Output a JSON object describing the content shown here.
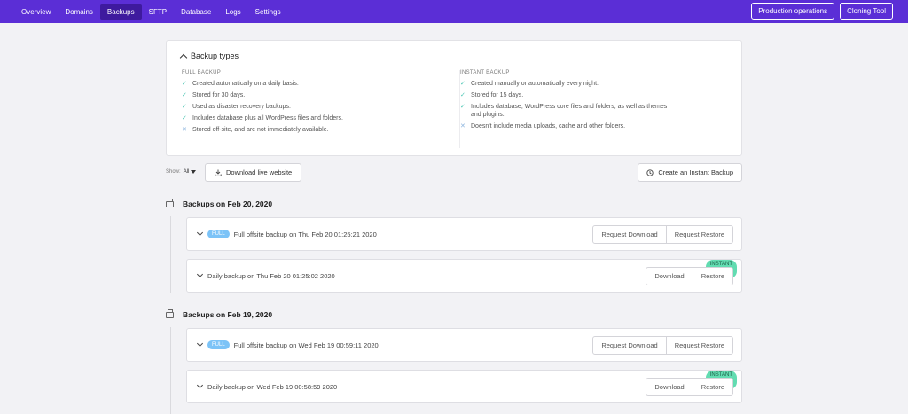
{
  "nav": {
    "items": [
      "Overview",
      "Domains",
      "Backups",
      "SFTP",
      "Database",
      "Logs",
      "Settings"
    ],
    "active": "Backups",
    "actions": [
      "Production operations",
      "Cloning Tool"
    ]
  },
  "types": {
    "title": "Backup types",
    "full": {
      "heading": "FULL BACKUP",
      "items": [
        {
          "text": "Created automatically on a daily basis.",
          "mark": "check"
        },
        {
          "text": "Stored for 30 days.",
          "mark": "check"
        },
        {
          "text": "Used as disaster recovery backups.",
          "mark": "check"
        },
        {
          "text": "Includes database plus all WordPress files and folders.",
          "mark": "check"
        },
        {
          "text": "Stored off-site, and are not immediately available.",
          "mark": "cross"
        }
      ]
    },
    "instant": {
      "heading": "INSTANT BACKUP",
      "items": [
        {
          "text": "Created manually or automatically every night.",
          "mark": "check"
        },
        {
          "text": "Stored for 15 days.",
          "mark": "check"
        },
        {
          "text": "Includes database, WordPress core files and folders, as well as themes and plugins.",
          "mark": "check"
        },
        {
          "text": "Doesn't include media uploads, cache and other folders.",
          "mark": "cross"
        }
      ]
    }
  },
  "controls": {
    "show_label": "Show:",
    "show_value": "All",
    "download_live": "Download live website",
    "create_instant": "Create an Instant Backup"
  },
  "groups": [
    {
      "title": "Backups on Feb 20, 2020",
      "rows": [
        {
          "badge": "FULL",
          "text": "Full offsite backup on Thu Feb 20 01:25:21 2020",
          "btn1": "Request Download",
          "btn2": "Request Restore"
        },
        {
          "badge": "INSTANT",
          "text": "Daily backup on Thu Feb 20 01:25:02 2020",
          "btn1": "Download",
          "btn2": "Restore"
        }
      ]
    },
    {
      "title": "Backups on Feb 19, 2020",
      "rows": [
        {
          "badge": "FULL",
          "text": "Full offsite backup on Wed Feb 19 00:59:11 2020",
          "btn1": "Request Download",
          "btn2": "Request Restore"
        },
        {
          "badge": "INSTANT",
          "text": "Daily backup on Wed Feb 19 00:58:59 2020",
          "btn1": "Download",
          "btn2": "Restore"
        }
      ]
    }
  ],
  "colors": {
    "topbar": "#5b2ed6",
    "active_tab": "#3e1a9e",
    "full_badge": "#7cc3f7",
    "instant_badge": "#62dcb1"
  }
}
